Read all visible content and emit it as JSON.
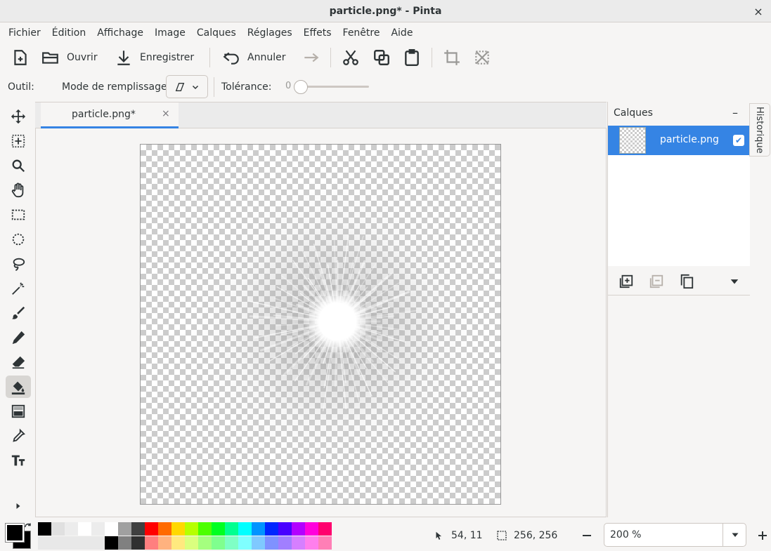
{
  "window": {
    "title": "particle.png* - Pinta",
    "close_glyph": "×"
  },
  "menu": [
    "Fichier",
    "Édition",
    "Affichage",
    "Image",
    "Calques",
    "Réglages",
    "Effets",
    "Fenêtre",
    "Aide"
  ],
  "toolbar": {
    "open_label": "Ouvrir",
    "save_label": "Enregistrer",
    "undo_label": "Annuler"
  },
  "options": {
    "tool_label": "Outil:",
    "fill_mode_label": "Mode de remplissage:",
    "tolerance_label": "Tolérance:",
    "tolerance_value": "0"
  },
  "tabs": [
    {
      "label": "particle.png*",
      "close": "×"
    }
  ],
  "layers_panel": {
    "title": "Calques",
    "collapse": "–",
    "layers": [
      {
        "name": "particle.png",
        "visible": true
      }
    ]
  },
  "history_tab": {
    "label": "Historique"
  },
  "tools": [
    "move-selected",
    "move-selection",
    "zoom",
    "pan",
    "rectangle-select",
    "ellipse-select",
    "lasso-select",
    "magic-wand",
    "paintbrush",
    "pencil",
    "eraser",
    "paint-bucket",
    "gradient",
    "color-picker",
    "text"
  ],
  "active_tool": "paint-bucket",
  "palette": {
    "primary_color": "#000000",
    "secondary_color": "#000000",
    "top_row": [
      "#000000",
      "#e0e0e0",
      "#ececec",
      "#ffffff",
      "#ececec",
      "#ffffff",
      "#a0a0a0",
      "#404040",
      "#ff0000",
      "#ff6a00",
      "#ffd800",
      "#b6ff00",
      "#4cff00",
      "#00ff21",
      "#00ff90",
      "#00ffff",
      "#0094ff",
      "#0026ff",
      "#4800ff",
      "#b200ff",
      "#ff00dc",
      "#ff006e"
    ],
    "bottom_row": [
      "#e8e8e8",
      "#e8e8e8",
      "#e8e8e8",
      "#e8e8e8",
      "#e8e8e8",
      "#000000",
      "#808080",
      "#303030",
      "#ff7f7f",
      "#ffb27f",
      "#ffe97f",
      "#daff7f",
      "#a5ff7f",
      "#7fff8e",
      "#7fffc5",
      "#7fffff",
      "#7fc9ff",
      "#7f92ff",
      "#a17fff",
      "#d67fff",
      "#ff7fed",
      "#ff7fb6"
    ]
  },
  "status": {
    "cursor_pos": "54, 11",
    "selection_size": "256, 256",
    "zoom": "200 %"
  }
}
